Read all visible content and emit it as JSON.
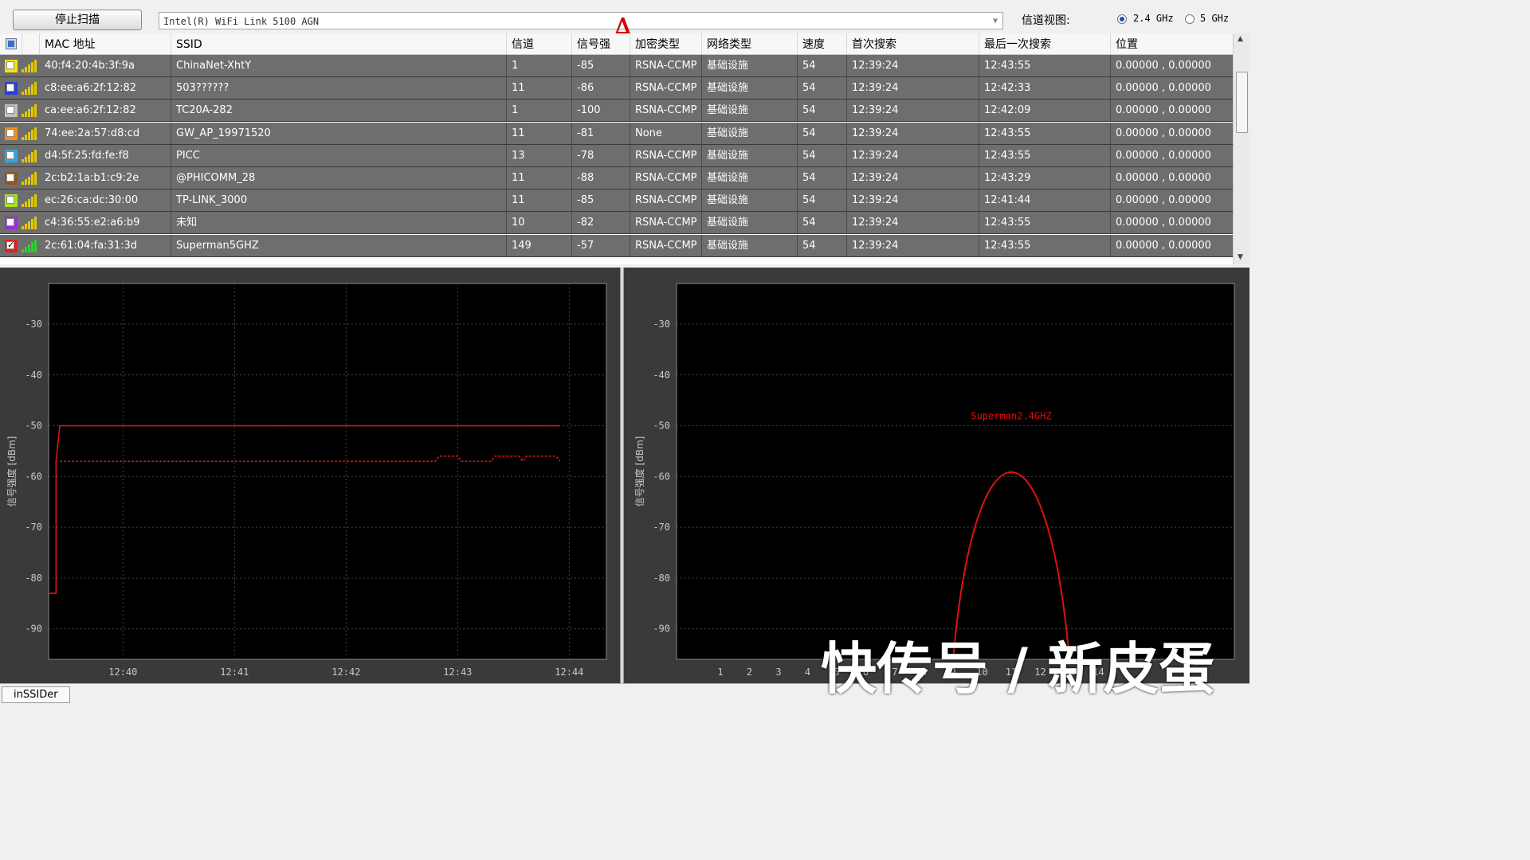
{
  "toolbar": {
    "stop_scan_label": "停止扫描",
    "adapter_value": "Intel(R) WiFi Link 5100 AGN",
    "channel_view_label": "信道视图:",
    "band_options": [
      {
        "label": "2.4 GHz",
        "selected": true
      },
      {
        "label": "5 GHz",
        "selected": false
      }
    ],
    "annotation_label": "A"
  },
  "table": {
    "columns": [
      "MAC 地址",
      "SSID",
      "信道",
      "信号强",
      "加密类型",
      "网络类型",
      "速度",
      "首次搜索",
      "最后一次搜索",
      "位置"
    ],
    "rows": [
      {
        "color": "#f2e400",
        "checked": false,
        "mac": "40:f4:20:4b:3f:9a",
        "ssid": "ChinaNet-XhtY",
        "channel": "1",
        "rssi": "-85",
        "security": "RSNA-CCMP",
        "network_type": "基础设施",
        "speed": "54",
        "first_seen": "12:39:24",
        "last_seen": "12:43:55",
        "location": "0.00000 , 0.00000"
      },
      {
        "color": "#2a3fd0",
        "checked": false,
        "mac": "c8:ee:a6:2f:12:82",
        "ssid": "503??????",
        "channel": "11",
        "rssi": "-86",
        "security": "RSNA-CCMP",
        "network_type": "基础设施",
        "speed": "54",
        "first_seen": "12:39:24",
        "last_seen": "12:42:33",
        "location": "0.00000 , 0.00000"
      },
      {
        "color": "#c0c0c0",
        "checked": false,
        "mac": "ca:ee:a6:2f:12:82",
        "ssid": "TC20A-282",
        "channel": "1",
        "rssi": "-100",
        "security": "RSNA-CCMP",
        "network_type": "基础设施",
        "speed": "54",
        "first_seen": "12:39:24",
        "last_seen": "12:42:09",
        "location": "0.00000 , 0.00000"
      },
      {
        "color": "#f09020",
        "checked": false,
        "mac": "74:ee:2a:57:d8:cd",
        "ssid": "GW_AP_19971520",
        "channel": "11",
        "rssi": "-81",
        "security": "None",
        "network_type": "基础设施",
        "speed": "54",
        "first_seen": "12:39:24",
        "last_seen": "12:43:55",
        "location": "0.00000 , 0.00000"
      },
      {
        "color": "#30a8e0",
        "checked": false,
        "mac": "d4:5f:25:fd:fe:f8",
        "ssid": "PICC",
        "channel": "13",
        "rssi": "-78",
        "security": "RSNA-CCMP",
        "network_type": "基础设施",
        "speed": "54",
        "first_seen": "12:39:24",
        "last_seen": "12:43:55",
        "location": "0.00000 , 0.00000"
      },
      {
        "color": "#8a5a20",
        "checked": false,
        "mac": "2c:b2:1a:b1:c9:2e",
        "ssid": "@PHICOMM_28",
        "channel": "11",
        "rssi": "-88",
        "security": "RSNA-CCMP",
        "network_type": "基础设施",
        "speed": "54",
        "first_seen": "12:39:24",
        "last_seen": "12:43:29",
        "location": "0.00000 , 0.00000"
      },
      {
        "color": "#a8e020",
        "checked": false,
        "mac": "ec:26:ca:dc:30:00",
        "ssid": "TP-LINK_3000",
        "channel": "11",
        "rssi": "-85",
        "security": "RSNA-CCMP",
        "network_type": "基础设施",
        "speed": "54",
        "first_seen": "12:39:24",
        "last_seen": "12:41:44",
        "location": "0.00000 , 0.00000"
      },
      {
        "color": "#9a30d0",
        "checked": false,
        "mac": "c4:36:55:e2:a6:b9",
        "ssid": "未知",
        "channel": "10",
        "rssi": "-82",
        "security": "RSNA-CCMP",
        "network_type": "基础设施",
        "speed": "54",
        "first_seen": "12:39:24",
        "last_seen": "12:43:55",
        "location": "0.00000 , 0.00000"
      },
      {
        "color": "#e02020",
        "checked": true,
        "mac": "2c:61:04:fa:31:3d",
        "ssid": "Superman5GHZ",
        "channel": "149",
        "rssi": "-57",
        "security": "RSNA-CCMP",
        "network_type": "基础设施",
        "speed": "54",
        "first_seen": "12:39:24",
        "last_seen": "12:43:55",
        "location": "0.00000 , 0.00000"
      }
    ]
  },
  "chart_data": [
    {
      "type": "line",
      "ylabel": "信号强度 [dBm]",
      "ylim": [
        -96,
        -22
      ],
      "y_ticks": [
        -30,
        -40,
        -50,
        -60,
        -70,
        -80,
        -90
      ],
      "x_ticks": [
        "12:40",
        "12:41",
        "12:42",
        "12:43",
        "12:44"
      ],
      "series": [
        {
          "style": "solid",
          "color": "#e01010",
          "points": [
            [
              "12:39:20",
              -83
            ],
            [
              "12:39:24",
              -83
            ],
            [
              "12:39:24",
              -57
            ],
            [
              "12:39:26",
              -50
            ],
            [
              "12:43:55",
              -50
            ]
          ]
        },
        {
          "style": "dashed",
          "color": "#e01010",
          "points": [
            [
              "12:39:26",
              -57
            ],
            [
              "12:42:48",
              -57
            ],
            [
              "12:42:50",
              -56
            ],
            [
              "12:43:00",
              -56
            ],
            [
              "12:43:02",
              -57
            ],
            [
              "12:43:18",
              -57
            ],
            [
              "12:43:20",
              -56
            ],
            [
              "12:43:33",
              -56
            ],
            [
              "12:43:35",
              -57
            ],
            [
              "12:43:37",
              -56
            ],
            [
              "12:43:53",
              -56
            ],
            [
              "12:43:55",
              -57
            ]
          ]
        }
      ]
    },
    {
      "type": "area",
      "ylabel": "信号强度 [dBm]",
      "ylim": [
        -96,
        -22
      ],
      "y_ticks": [
        -30,
        -40,
        -50,
        -60,
        -70,
        -80,
        -90
      ],
      "x_ticks": [
        "1",
        "2",
        "3",
        "4",
        "5",
        "6",
        "7",
        "8",
        "9",
        "10",
        "11",
        "12",
        "13",
        "14"
      ],
      "series": [
        {
          "name": "Superman2.4GHZ",
          "center_channel": 11,
          "peak_dbm": -50,
          "color": "#e01010"
        }
      ]
    }
  ],
  "statusbar": {
    "app_tab": "inSSIDer"
  },
  "watermark": "快传号 / 新皮蛋"
}
